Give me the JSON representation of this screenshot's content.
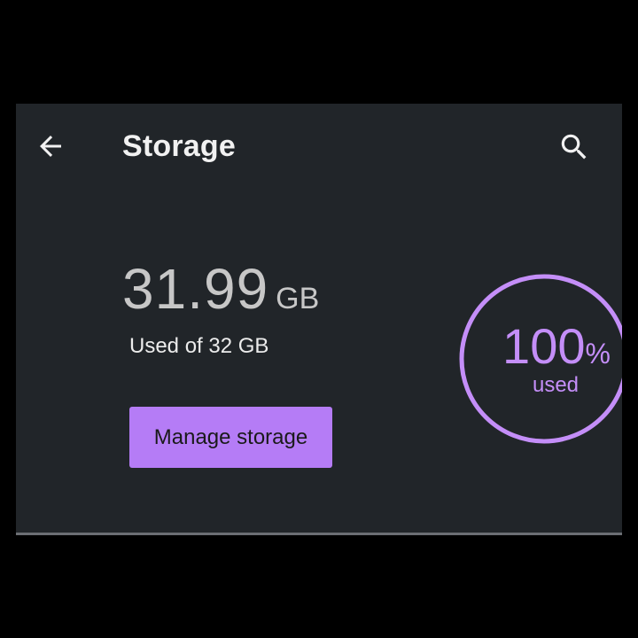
{
  "app_bar": {
    "back_icon": "arrow-left-icon",
    "title": "Storage",
    "search_icon": "search-icon"
  },
  "storage": {
    "used_value": "31.99",
    "used_unit": "GB",
    "caption": "Used of 32 GB",
    "manage_label": "Manage storage",
    "percent_value": "100",
    "percent_sign": "%",
    "percent_caption": "used",
    "percent_fraction": 1.0
  },
  "colors": {
    "background": "#212529",
    "accent": "#b57cf6",
    "ring": "#c48ef8"
  }
}
